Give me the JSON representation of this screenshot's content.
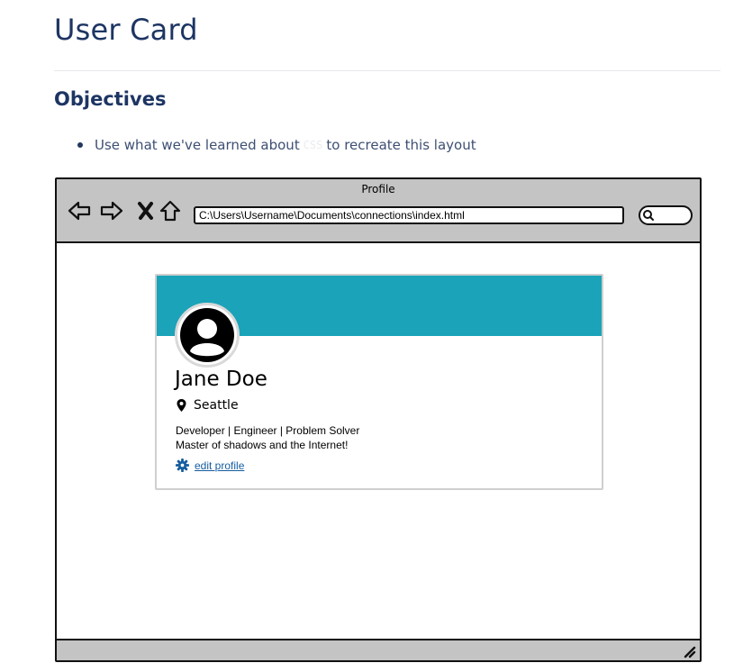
{
  "page": {
    "title": "User Card",
    "section_title": "Objectives",
    "objective": {
      "before": "Use what we've learned about",
      "code": "CSS",
      "after": "to recreate this layout"
    }
  },
  "browser": {
    "tab_title": "Profile",
    "address": "C:\\Users\\Username\\Documents\\connections\\index.html",
    "icons": [
      "back-arrow-icon",
      "forward-arrow-icon",
      "close-icon",
      "home-icon",
      "search-icon",
      "resize-grip-icon"
    ]
  },
  "card": {
    "name": "Jane Doe",
    "location": "Seattle",
    "bio_line1": "Developer | Engineer | Problem Solver",
    "bio_line2": "Master of shadows and the Internet!",
    "edit_label": "edit profile",
    "banner_color": "#1ba3b9",
    "link_color": "#155d9e"
  }
}
